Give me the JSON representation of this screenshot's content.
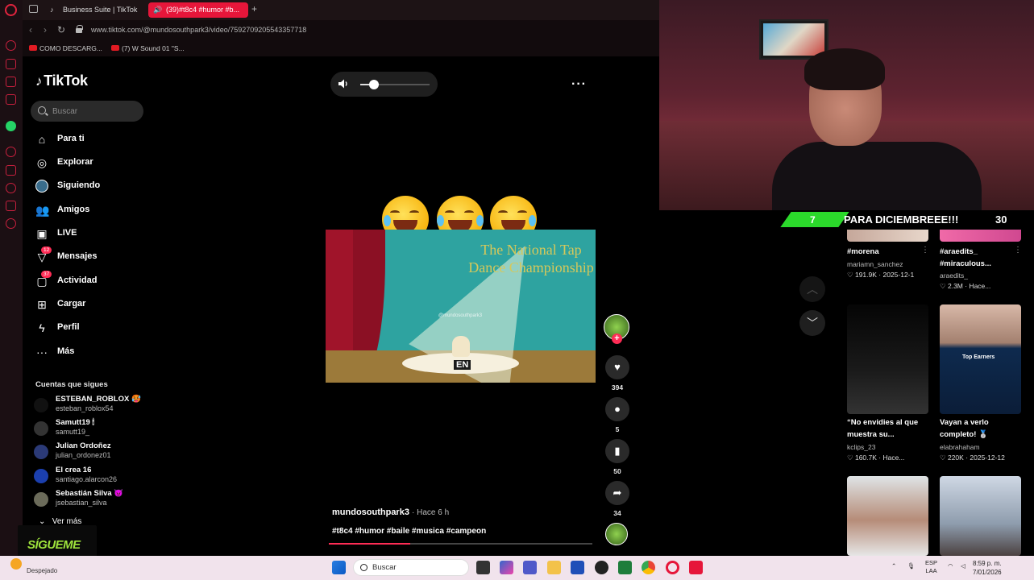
{
  "browser": {
    "tabs": [
      {
        "label": "Business Suite | TikTok",
        "active": false
      },
      {
        "label": "(39)#t8c4 #humor #b...",
        "active": true
      }
    ],
    "url": "www.tiktok.com/@mundosouthpark3/video/7592709205543357718",
    "bookmarks": [
      "COMO DESCARG...",
      "(7) W Sound 01 \"S..."
    ]
  },
  "tiktok": {
    "logo": "TikTok",
    "search_placeholder": "Buscar",
    "nav": [
      {
        "label": "Para ti",
        "icon": "home-icon"
      },
      {
        "label": "Explorar",
        "icon": "compass-icon"
      },
      {
        "label": "Siguiendo",
        "icon": "following-avatar-icon"
      },
      {
        "label": "Amigos",
        "icon": "friends-icon"
      },
      {
        "label": "LIVE",
        "icon": "live-icon"
      },
      {
        "label": "Mensajes",
        "icon": "messages-icon",
        "badge": "12"
      },
      {
        "label": "Actividad",
        "icon": "activity-icon",
        "badge": "37"
      },
      {
        "label": "Cargar",
        "icon": "upload-icon"
      },
      {
        "label": "Perfil",
        "icon": "profile-icon"
      },
      {
        "label": "Más",
        "icon": "more-icon"
      }
    ],
    "following_header": "Cuentas que sigues",
    "following": [
      {
        "name": "ESTEBAN_ROBLOX 🥵",
        "user": "esteban_roblox54"
      },
      {
        "name": "Samutt19 🕯",
        "user": "samutt19_"
      },
      {
        "name": "Julian Ordoñez",
        "user": "julian_ordonez01"
      },
      {
        "name": "El crea 16",
        "user": "santiago.alarcon26"
      },
      {
        "name": "Sebastián Silva 😈",
        "user": "jsebastian_silva"
      }
    ],
    "see_more": "Ver más"
  },
  "video": {
    "volume": 0.2,
    "emojis": [
      "🤣",
      "😂",
      "🤣"
    ],
    "stage_title": "The National Tap Dance Championship",
    "watermark": "@mundosouthpark3",
    "en_tag": "EN",
    "author": "mundosouthpark3",
    "time": "· Hace 6 h",
    "hashtags": "#t8c4 #humor #baile #musica #campeon",
    "progress": 0.31,
    "actions": {
      "likes": "394",
      "comments": "5",
      "saves": "50",
      "shares": "34"
    }
  },
  "overlay": {
    "banner_left": "7",
    "banner_text": "PARA DICIEMBREEE!!!",
    "banner_right": "30",
    "sigueme": "SÍGUEME"
  },
  "grid": [
    {
      "title": "#morena",
      "user": "mariamn_sanchez",
      "stats": "♡ 191.9K · 2025-12-1"
    },
    {
      "title": "#araedits_ #miraculous...",
      "user": "araedits_",
      "stats": "♡ 2.3M · Hace..."
    },
    {
      "title": "“No envidies al que muestra su...",
      "user": "kclips_23",
      "stats": "♡ 160.7K · Hace..."
    },
    {
      "title": "Vayan a verlo completo! 🥈",
      "user": "elabrahaham",
      "stats": "♡ 220K · 2025-12-12"
    },
    {
      "title": "",
      "user": "",
      "stats": ""
    },
    {
      "title": "",
      "user": "",
      "stats": ""
    }
  ],
  "grid_thumb_text": {
    "top_earners": "Top Earners"
  },
  "taskbar": {
    "weather": "Despejado",
    "search": "Buscar",
    "lang_top": "ESP",
    "lang_bottom": "LAA",
    "time": "8:59 p. m.",
    "date": "7/01/2026"
  },
  "colors": {
    "tiktok_red": "#fe2c55",
    "opera_red": "#e6163a",
    "banner_green": "#2bd92b"
  }
}
